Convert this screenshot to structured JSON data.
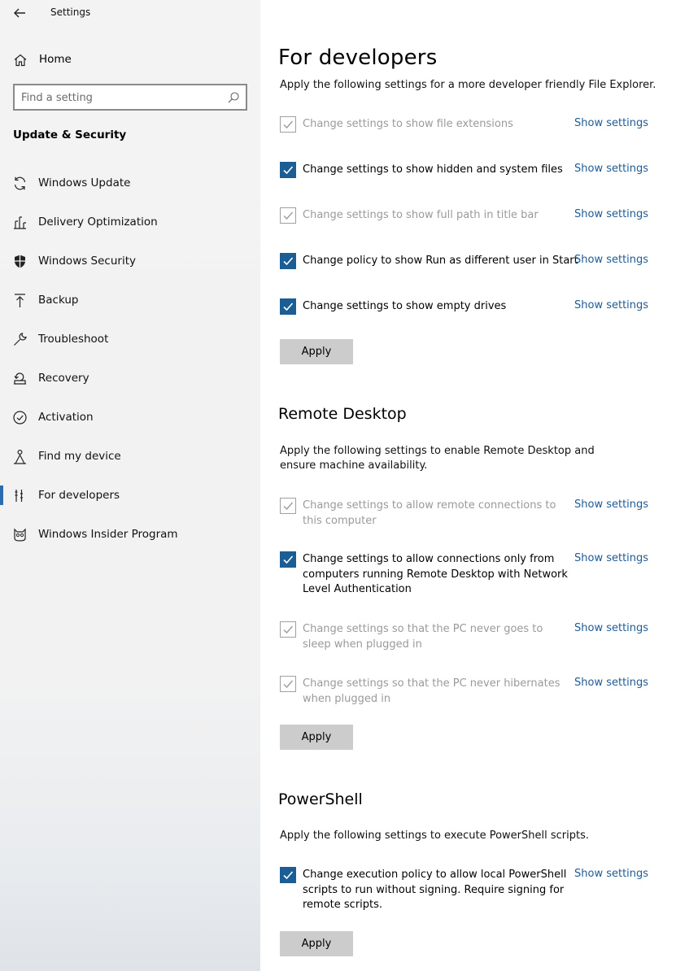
{
  "header": {
    "title": "Settings"
  },
  "sidebar": {
    "home_label": "Home",
    "search_placeholder": "Find a setting",
    "section_title": "Update & Security",
    "items": [
      {
        "label": "Windows Update",
        "icon": "refresh-icon"
      },
      {
        "label": "Delivery Optimization",
        "icon": "delivery-optimization-icon"
      },
      {
        "label": "Windows Security",
        "icon": "shield-icon"
      },
      {
        "label": "Backup",
        "icon": "backup-arrow-icon"
      },
      {
        "label": "Troubleshoot",
        "icon": "wrench-icon"
      },
      {
        "label": "Recovery",
        "icon": "recovery-icon"
      },
      {
        "label": "Activation",
        "icon": "check-circle-icon"
      },
      {
        "label": "Find my device",
        "icon": "person-pin-icon"
      },
      {
        "label": "For developers",
        "icon": "developer-tools-icon",
        "active": true
      },
      {
        "label": "Windows Insider Program",
        "icon": "insider-cat-icon"
      }
    ]
  },
  "main": {
    "title": "For developers",
    "file_explorer": {
      "description": "Apply the following settings for a more developer friendly File Explorer.",
      "options": [
        {
          "label": "Change settings to show file extensions",
          "link": "Show settings",
          "checked": true,
          "disabled": true
        },
        {
          "label": "Change settings to show hidden and system files",
          "link": "Show settings",
          "checked": true,
          "disabled": false
        },
        {
          "label": "Change settings to show full path in title bar",
          "link": "Show settings",
          "checked": true,
          "disabled": true
        },
        {
          "label": "Change policy to show Run as different user in Start",
          "link": "Show settings",
          "checked": true,
          "disabled": false
        },
        {
          "label": "Change settings to show empty drives",
          "link": "Show settings",
          "checked": true,
          "disabled": false
        }
      ],
      "apply_label": "Apply"
    },
    "remote_desktop": {
      "title": "Remote Desktop",
      "description": "Apply the following settings to enable Remote Desktop and ensure machine availability.",
      "options": [
        {
          "label": "Change settings to allow remote connections to this computer",
          "link": "Show settings",
          "checked": true,
          "disabled": true
        },
        {
          "label": "Change settings to allow connections only from computers running Remote Desktop with Network Level Authentication",
          "link": "Show settings",
          "checked": true,
          "disabled": false
        },
        {
          "label": "Change settings so that the PC never goes to sleep when plugged in",
          "link": "Show settings",
          "checked": true,
          "disabled": true
        },
        {
          "label": "Change settings so that the PC never hibernates when plugged in",
          "link": "Show settings",
          "checked": true,
          "disabled": true
        }
      ],
      "apply_label": "Apply"
    },
    "powershell": {
      "title": "PowerShell",
      "description": "Apply the following settings to execute PowerShell scripts.",
      "options": [
        {
          "label": "Change execution policy to allow local PowerShell scripts to run without signing. Require signing for remote scripts.",
          "link": "Show settings",
          "checked": true,
          "disabled": false
        }
      ],
      "apply_label": "Apply"
    }
  },
  "colors": {
    "accent": "#1b5e95",
    "link": "#1e5b96",
    "disabled_text": "#9a9a9a",
    "button_bg": "#cccccc"
  }
}
